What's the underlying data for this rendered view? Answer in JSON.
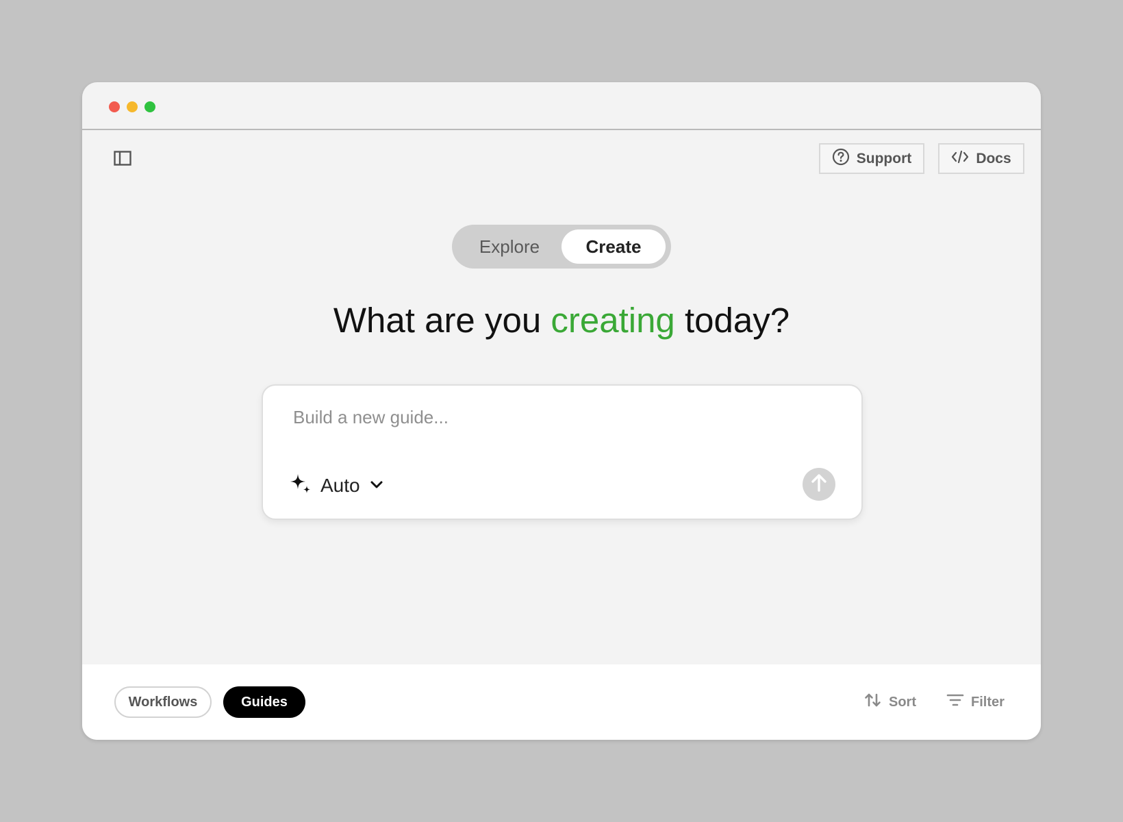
{
  "header": {
    "support_label": "Support",
    "docs_label": "Docs"
  },
  "mode_switch": {
    "tabs": [
      {
        "label": "Explore",
        "selected": false
      },
      {
        "label": "Create",
        "selected": true
      }
    ]
  },
  "hero": {
    "prefix": "What are you ",
    "accent": "creating",
    "suffix": " today?",
    "accent_color": "#3aa836"
  },
  "composer": {
    "value": "",
    "placeholder": "Build a new guide...",
    "mode_label": "Auto",
    "mode_icon": "sparkle-icon",
    "send_icon": "arrow-up-icon"
  },
  "footer": {
    "tabs": [
      {
        "label": "Workflows",
        "selected": false
      },
      {
        "label": "Guides",
        "selected": true
      }
    ],
    "sort_label": "Sort",
    "filter_label": "Filter"
  }
}
